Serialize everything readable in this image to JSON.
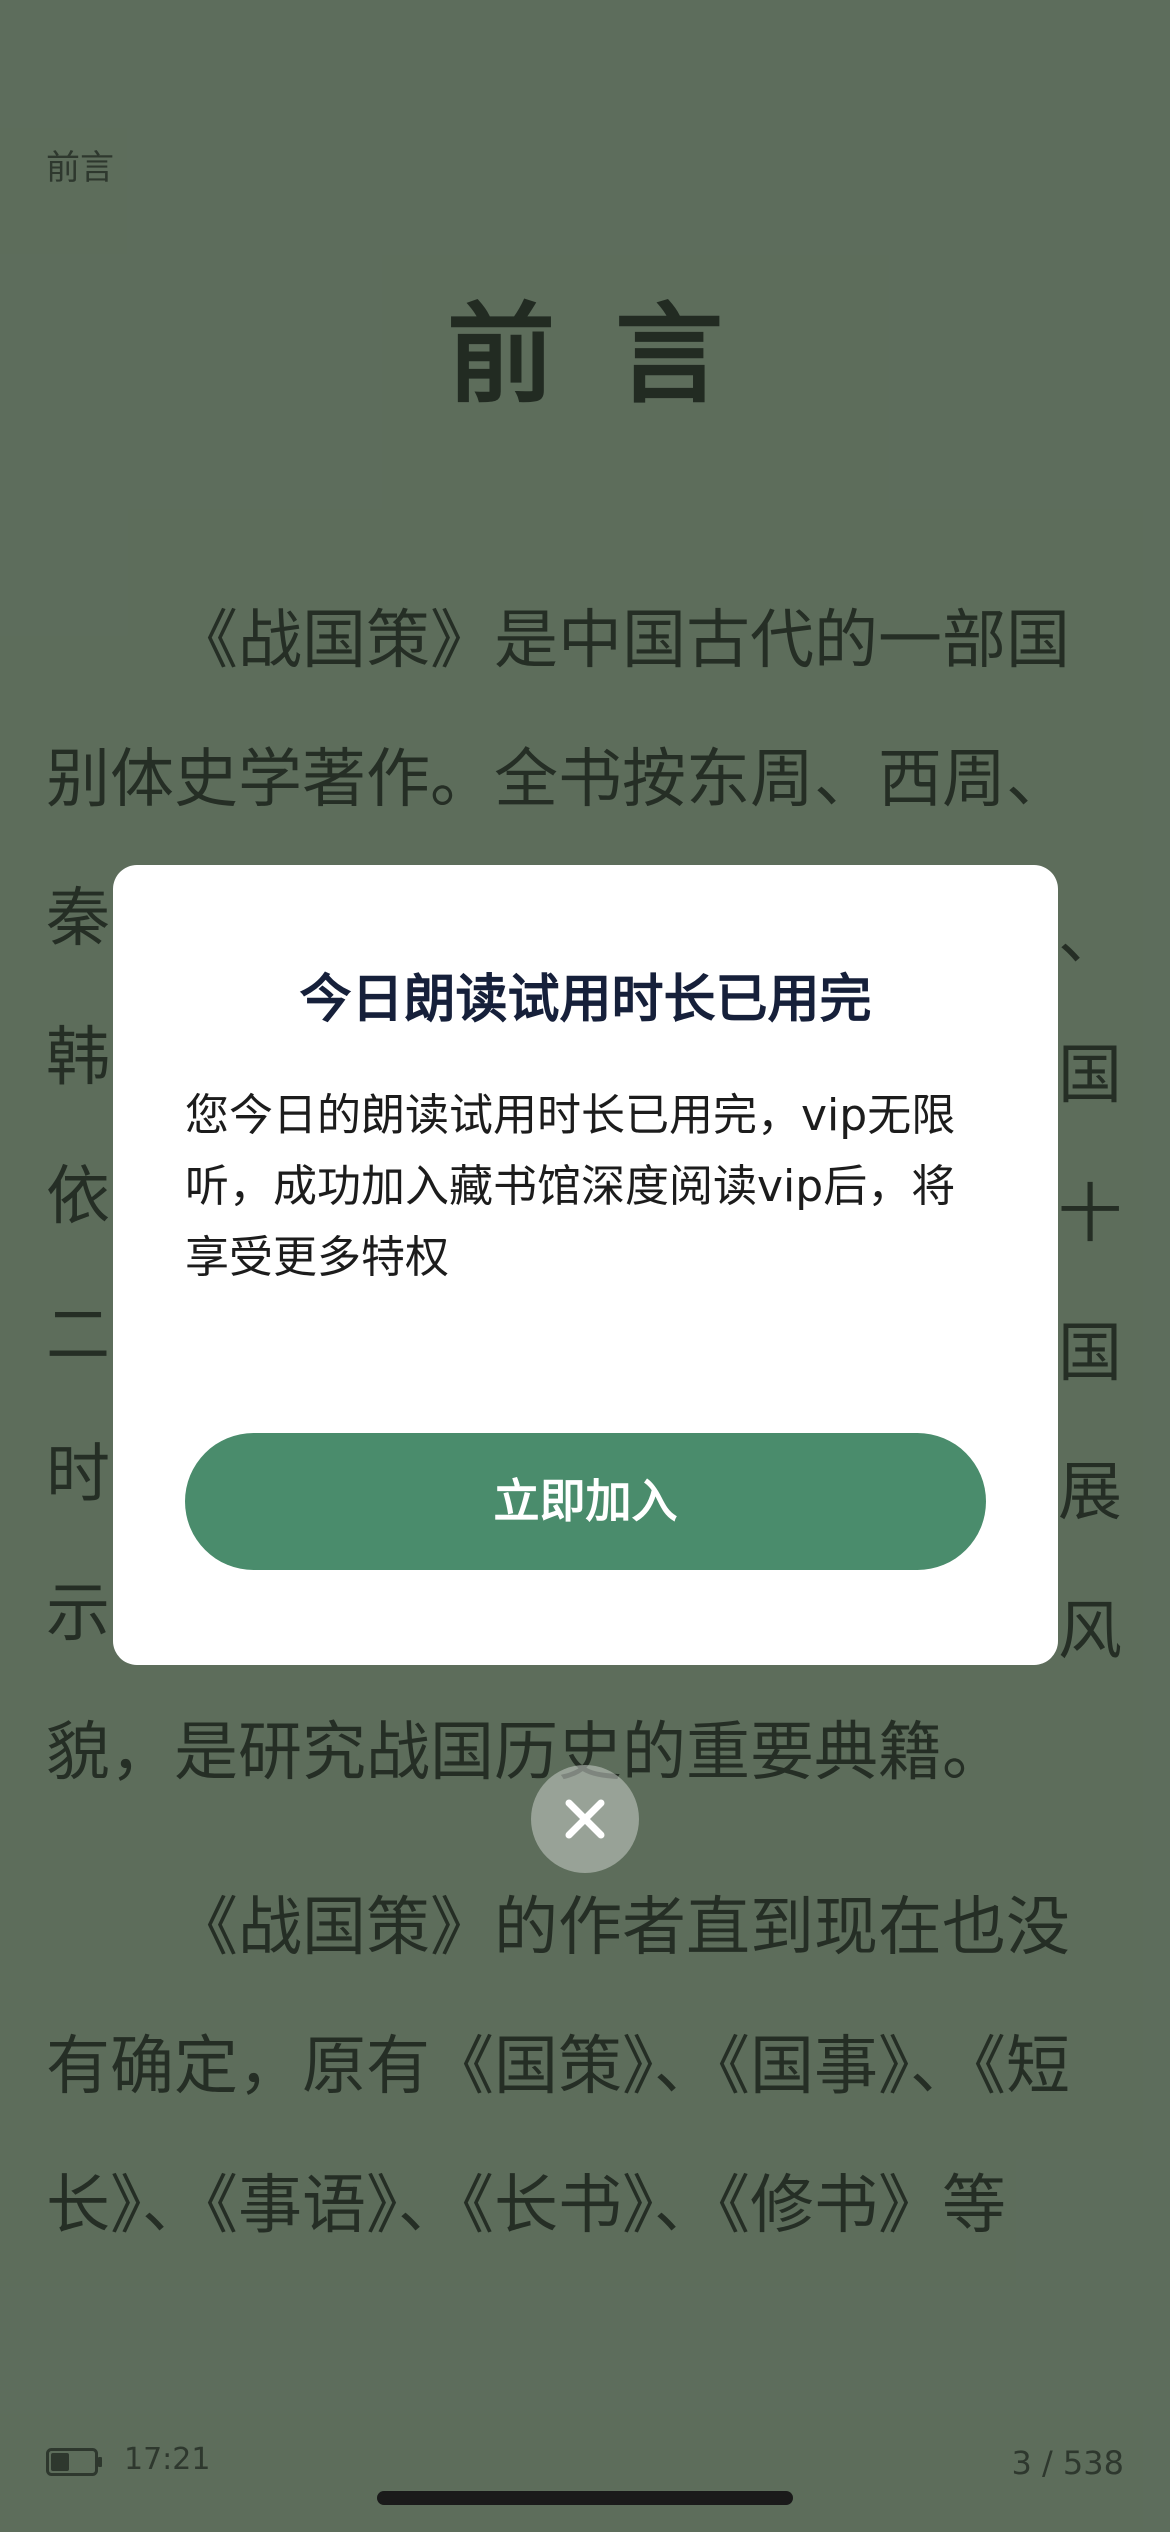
{
  "reader": {
    "breadcrumb": "前言",
    "chapter_title": "前言",
    "lines": [
      {
        "text": "《战国策》是中国古代的一部国",
        "indent": true
      },
      {
        "text": "别体史学著作。全书按东周、西周、",
        "indent": false
      },
      {
        "text": "秦",
        "indent": false
      },
      {
        "text": "韩",
        "indent": false
      },
      {
        "text": "依",
        "indent": false
      },
      {
        "text": "二",
        "indent": false
      },
      {
        "text": "时",
        "indent": false
      },
      {
        "text": "示",
        "indent": false
      },
      {
        "text": "貌，是研究战国历史的重要典籍。",
        "indent": false
      },
      {
        "text": "《战国策》的作者直到现在也没",
        "indent": true,
        "gap": true
      },
      {
        "text": "有确定，原有《国策》、《国事》、《短",
        "indent": false
      },
      {
        "text": "长》、《事语》、《长书》、《修书》等",
        "indent": false
      }
    ],
    "right_edge_chars": [
      "、",
      "国",
      "十",
      "国",
      "展",
      "风"
    ]
  },
  "dialog": {
    "title": "今日朗读试用时长已用完",
    "body": "您今日的朗读试用时长已用完，vip无限听，成功加入藏书馆深度阅读vip后，将享受更多特权",
    "join_label": "立即加入"
  },
  "status": {
    "time": "17:21",
    "battery_level": 0.45,
    "page_indicator": "3 / 538"
  },
  "colors": {
    "background": "#6a7a68",
    "button": "#4a8c6c"
  },
  "icons": {
    "close": "close-icon",
    "battery": "battery-icon"
  }
}
